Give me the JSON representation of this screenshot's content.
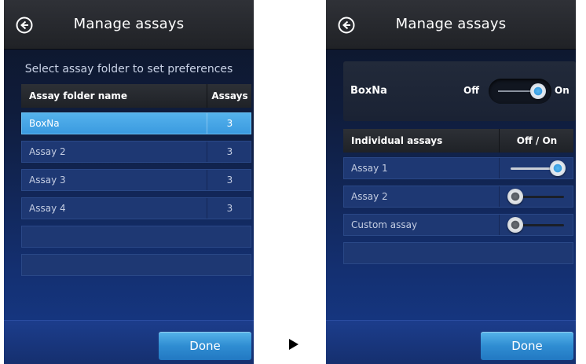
{
  "left_screen": {
    "title": "Manage assays",
    "instruction": "Select assay folder to set preferences",
    "table": {
      "columns": [
        "Assay folder name",
        "Assays"
      ],
      "rows": [
        {
          "name": "BoxNa",
          "count": "3",
          "selected": true
        },
        {
          "name": "Assay 2",
          "count": "3",
          "selected": false
        },
        {
          "name": "Assay 3",
          "count": "3",
          "selected": false
        },
        {
          "name": "Assay 4",
          "count": "3",
          "selected": false
        }
      ]
    },
    "done_label": "Done"
  },
  "right_screen": {
    "title": "Manage assays",
    "folder": {
      "name": "BoxNa",
      "off_label": "Off",
      "on_label": "On",
      "state": "on"
    },
    "assays_table": {
      "columns": [
        "Individual assays",
        "Off / On"
      ],
      "rows": [
        {
          "name": "Assay 1",
          "state": "on"
        },
        {
          "name": "Assay 2",
          "state": "off"
        },
        {
          "name": "Custom assay",
          "state": "off"
        }
      ]
    },
    "done_label": "Done"
  },
  "icons": {
    "back": "back-arrow-icon",
    "transition": "play-arrow-icon"
  },
  "colors": {
    "accent": "#3a9ae0",
    "header": "#26282d",
    "background": "#0f1c3b"
  }
}
